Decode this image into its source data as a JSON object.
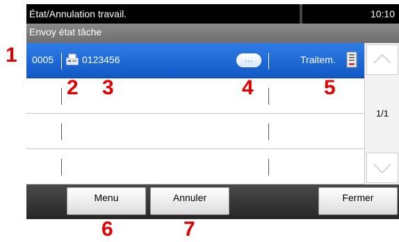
{
  "header": {
    "title": "État/Annulation travail.",
    "time": "10:10",
    "subtitle": "Envoy état tâche"
  },
  "jobs": [
    {
      "number": "0005",
      "destination": "0123456",
      "more_label": "…",
      "status": "Traitem."
    },
    {
      "number": "",
      "destination": "",
      "more_label": "",
      "status": ""
    },
    {
      "number": "",
      "destination": "",
      "more_label": "",
      "status": ""
    },
    {
      "number": "",
      "destination": "",
      "more_label": "",
      "status": ""
    }
  ],
  "scroll": {
    "page_indicator": "1/1"
  },
  "bottom_buttons": {
    "menu": "Menu",
    "cancel": "Annuler",
    "close": "Fermer"
  },
  "callouts": [
    "1",
    "2",
    "3",
    "4",
    "5",
    "6",
    "7"
  ],
  "colors": {
    "selected_row": "#1f6ad8",
    "callout": "#e00000"
  },
  "icons": {
    "send_type": "fax-send-icon",
    "status": "document-status-icon",
    "scroll_up": "chevron-up-icon",
    "scroll_down": "chevron-down-icon"
  }
}
